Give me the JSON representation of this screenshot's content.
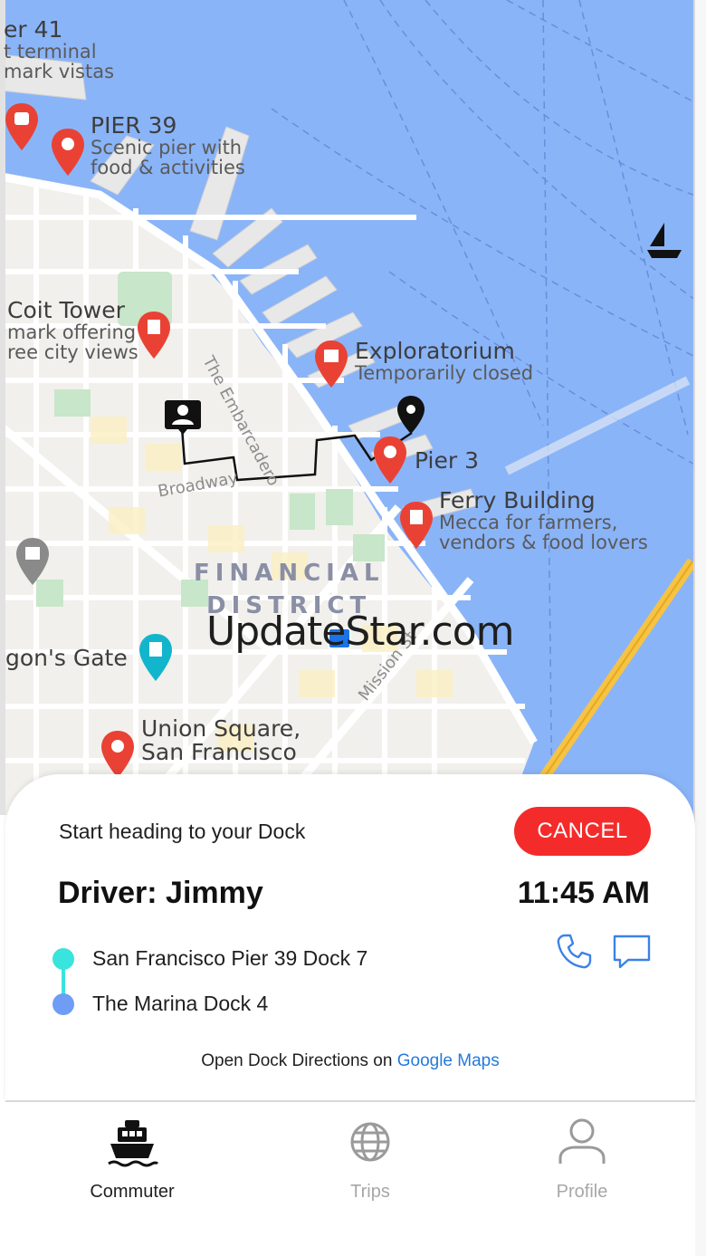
{
  "map": {
    "labels": {
      "pier41": {
        "title": "er 41",
        "sub1": "t terminal",
        "sub2": "mark vistas"
      },
      "pier39": {
        "title": "PIER 39",
        "sub1": "Scenic pier with",
        "sub2": "food & activities"
      },
      "coit": {
        "title": "Coit Tower",
        "sub1": "mark offering",
        "sub2": "ree city views"
      },
      "exploratorium": {
        "title": "Exploratorium",
        "sub1": "Temporarily closed"
      },
      "pier3": {
        "title": "Pier 3"
      },
      "ferry": {
        "title": "Ferry Building",
        "sub1": "Mecca for farmers,",
        "sub2": "vendors & food lovers"
      },
      "dragon": {
        "title": "gon's Gate"
      },
      "union": {
        "title": "Union Square,",
        "sub1": "San Francisco"
      }
    },
    "district_line1": "FINANCIAL",
    "district_line2": "DISTRICT",
    "streets": {
      "embarcadero": "The Embarcadero",
      "broadway": "Broadway",
      "mission": "Mission St"
    },
    "watermark": "UpdateStar.com",
    "colors": {
      "water": "#8ab4f8",
      "land": "#f1f0ec",
      "park": "#c8e6c9",
      "highway": "#f6c344"
    }
  },
  "sheet": {
    "status": "Start heading to your Dock",
    "cancel_label": "CANCEL",
    "driver": "Driver: Jimmy",
    "eta": "11:45 AM",
    "from": "San Francisco Pier 39 Dock 7",
    "to": "The Marina Dock 4",
    "directions_prefix": "Open Dock Directions on ",
    "directions_link": "Google Maps",
    "icons": {
      "call": "phone-icon",
      "message": "message-icon"
    },
    "accent": "#f42b2b",
    "link_color": "#2479de"
  },
  "tabs": [
    {
      "label": "Commuter",
      "icon": "ferry-icon",
      "active": true
    },
    {
      "label": "Trips",
      "icon": "globe-icon",
      "active": false
    },
    {
      "label": "Profile",
      "icon": "user-icon",
      "active": false
    }
  ]
}
